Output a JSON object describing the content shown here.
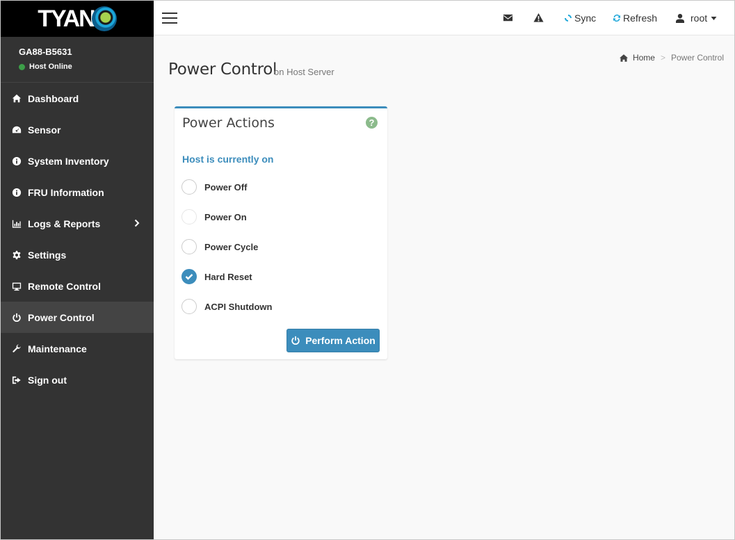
{
  "brand": {
    "logo_text": "TYAN"
  },
  "host": {
    "name": "GA88-B5631",
    "status": "Host Online",
    "status_color": "#3c9e48"
  },
  "sidebar": {
    "items": [
      {
        "label": "Dashboard",
        "icon": "home-icon"
      },
      {
        "label": "Sensor",
        "icon": "dashboard-icon"
      },
      {
        "label": "System Inventory",
        "icon": "info-icon"
      },
      {
        "label": "FRU Information",
        "icon": "info-icon"
      },
      {
        "label": "Logs & Reports",
        "icon": "bar-chart-icon",
        "has_submenu": true
      },
      {
        "label": "Settings",
        "icon": "gear-icon"
      },
      {
        "label": "Remote Control",
        "icon": "monitor-icon"
      },
      {
        "label": "Power Control",
        "icon": "power-icon",
        "active": true
      },
      {
        "label": "Maintenance",
        "icon": "wrench-icon"
      },
      {
        "label": "Sign out",
        "icon": "sign-out-icon"
      }
    ]
  },
  "topbar": {
    "sync_label": "Sync",
    "refresh_label": "Refresh",
    "user_label": "root",
    "icons": [
      "menu-icon",
      "envelope-icon",
      "warning-icon",
      "sync-icon",
      "refresh-icon",
      "user-icon",
      "caret-down-icon"
    ]
  },
  "page": {
    "title": "Power Control",
    "subtitle": "on Host Server",
    "breadcrumb": {
      "home": "Home",
      "separator": ">",
      "current": "Power Control"
    }
  },
  "panel": {
    "title": "Power Actions",
    "help_icon": "question-circle-icon",
    "host_state": "Host is currently on",
    "options": [
      {
        "label": "Power Off",
        "checked": false
      },
      {
        "label": "Power On",
        "checked": false
      },
      {
        "label": "Power Cycle",
        "checked": false
      },
      {
        "label": "Hard Reset",
        "checked": true
      },
      {
        "label": "ACPI Shutdown",
        "checked": false
      }
    ],
    "button_label": "Perform Action"
  },
  "colors": {
    "accent": "#3c8dbc",
    "sidebar_bg": "#333333",
    "help_green": "#8cbb8c"
  }
}
